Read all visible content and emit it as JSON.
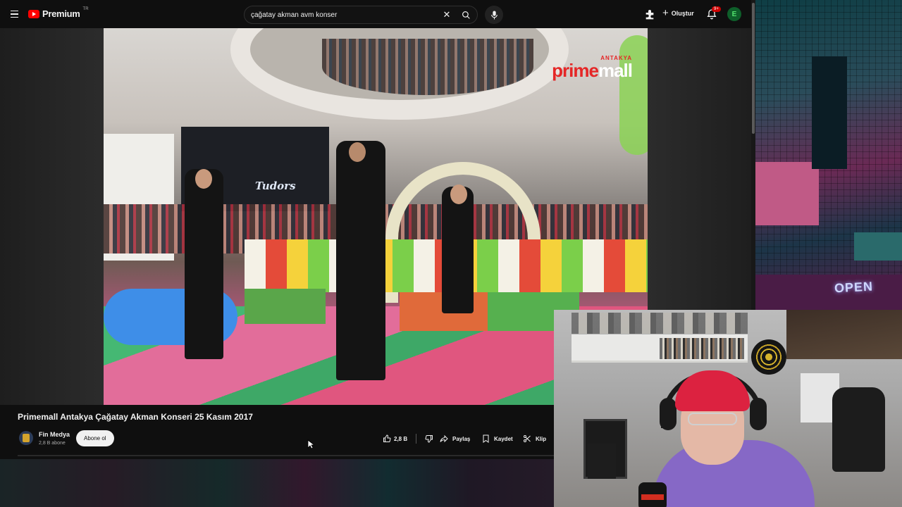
{
  "header": {
    "logo_text": "Premium",
    "logo_country": "TR",
    "search_value": "çağatay akman avm konser",
    "create_label": "Oluştur",
    "notifications_badge": "9+",
    "avatar_letter": "E"
  },
  "video": {
    "overlay_brand_top": "ANTAKYA",
    "overlay_brand_prime": "prime",
    "overlay_brand_mall": "mall",
    "store_sign": "Tudors"
  },
  "details": {
    "title": "Primemall Antakya Çağatay Akman Konseri 25 Kasım 2017",
    "channel_name": "Fin Medya",
    "subscribers": "2,8 B abone",
    "subscribe_label": "Abone ol",
    "like_count": "2,8 B",
    "share_label": "Paylaş",
    "save_label": "Kaydet",
    "clip_label": "Klip"
  },
  "overlay": {
    "neon_sign": "OPEN"
  },
  "colors": {
    "brand_red": "#ff0000",
    "background": "#0f0f0f",
    "text": "#f1f1f1",
    "secondary_text": "#aaaaaa",
    "badge": "#cc0000",
    "avatar_bg": "#0e5f2a"
  }
}
